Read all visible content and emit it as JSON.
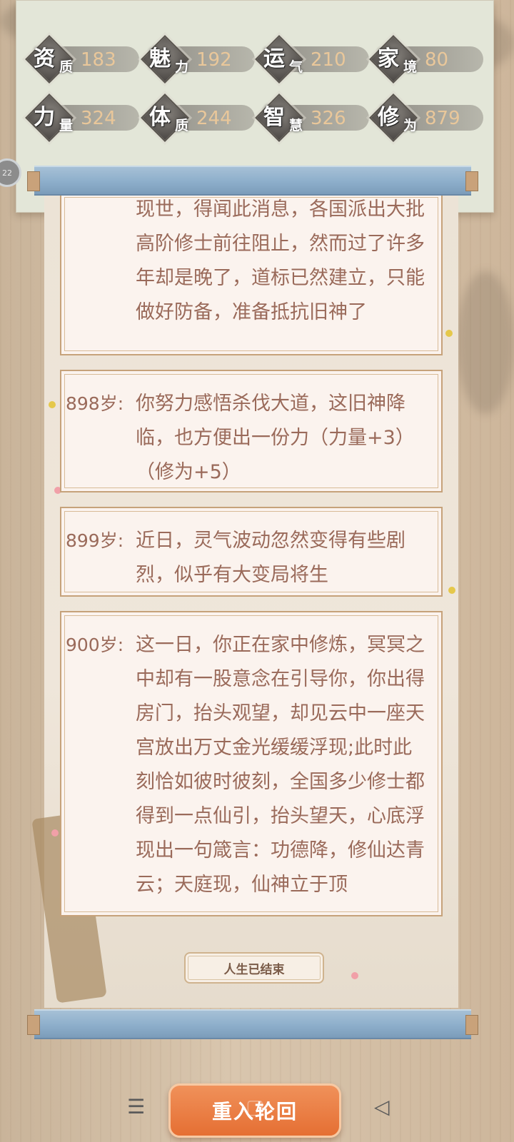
{
  "stats": [
    {
      "name_big": "资",
      "name_small": "质",
      "value": "183"
    },
    {
      "name_big": "魅",
      "name_small": "力",
      "value": "192"
    },
    {
      "name_big": "运",
      "name_small": "气",
      "value": "210"
    },
    {
      "name_big": "家",
      "name_small": "境",
      "value": "80"
    },
    {
      "name_big": "力",
      "name_small": "量",
      "value": "324"
    },
    {
      "name_big": "体",
      "name_small": "质",
      "value": "244"
    },
    {
      "name_big": "智",
      "name_small": "慧",
      "value": "326"
    },
    {
      "name_big": "修",
      "name_small": "为",
      "value": "879"
    }
  ],
  "side_badge": "22",
  "log": [
    {
      "age": "",
      "text": "现世，得闻此消息，各国派出大批高阶修士前往阻止，然而过了许多年却是晚了，道标已然建立，只能做好防备，准备抵抗旧神了"
    },
    {
      "age": "898岁:",
      "text": "你努力感悟杀伐大道，这旧神降临，也方便出一份力（力量+3）（修为+5）"
    },
    {
      "age": "899岁:",
      "text": "近日，灵气波动忽然变得有些剧烈，似乎有大变局将生"
    },
    {
      "age": "900岁:",
      "text": "这一日，你正在家中修炼，冥冥之中却有一股意念在引导你，你出得房门，抬头观望，却见云中一座天宫放出万丈金光缓缓浮现;此时此刻恰如彼时彼刻，全国多少修士都得到一点仙引，抬头望天，心底浮现出一句箴言：功德降，修仙达青云；天庭现，仙神立于顶"
    }
  ],
  "end_label": "人生已结束",
  "restart_label": "重入轮回",
  "nav": {
    "menu": "☰",
    "home": "▢",
    "back": "◁"
  }
}
